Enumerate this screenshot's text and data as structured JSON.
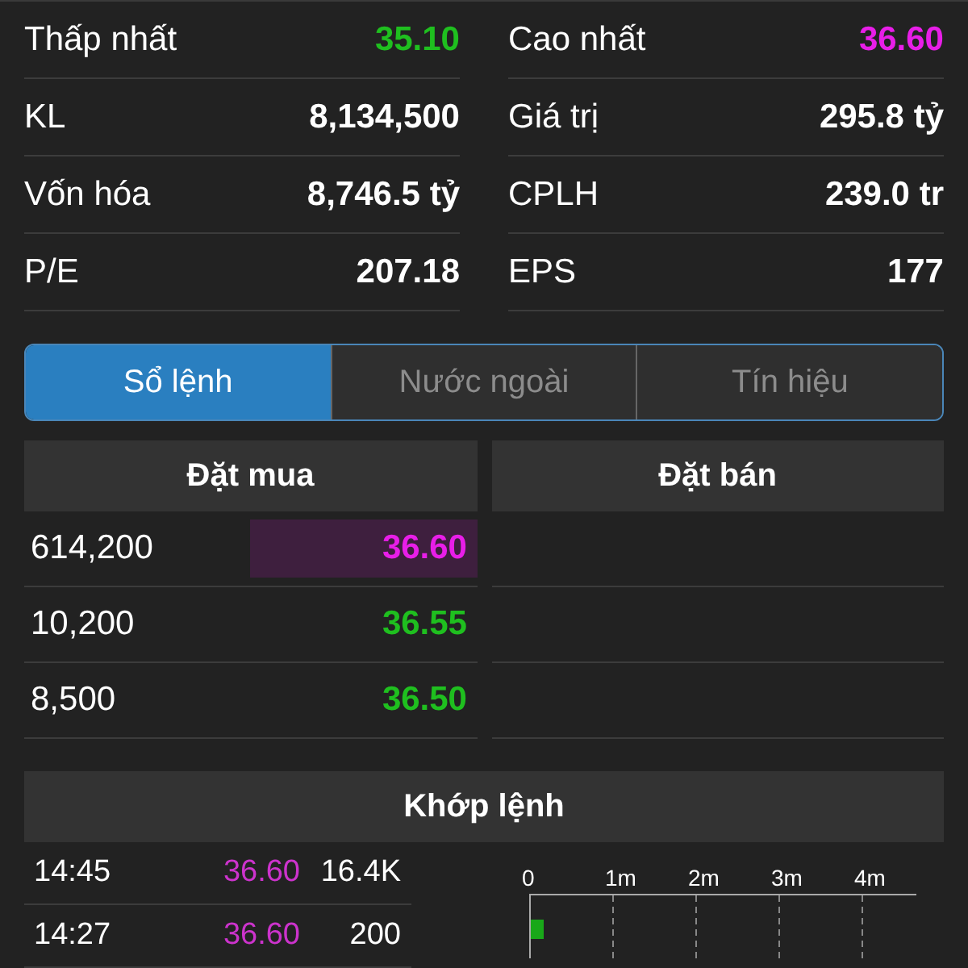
{
  "stats": [
    {
      "label": "Thấp nhất",
      "value": "35.10",
      "color": "#1fbf1f"
    },
    {
      "label": "Cao nhất",
      "value": "36.60",
      "color": "#e81ee8"
    },
    {
      "label": "KL",
      "value": "8,134,500",
      "color": "#ffffff"
    },
    {
      "label": "Giá trị",
      "value": "295.8 tỷ",
      "color": "#ffffff"
    },
    {
      "label": "Vốn hóa",
      "value": "8,746.5 tỷ",
      "color": "#ffffff"
    },
    {
      "label": "CPLH",
      "value": "239.0 tr",
      "color": "#ffffff"
    },
    {
      "label": "P/E",
      "value": "207.18",
      "color": "#ffffff"
    },
    {
      "label": "EPS",
      "value": "177",
      "color": "#ffffff"
    }
  ],
  "tabs": [
    {
      "label": "Sổ lệnh",
      "selected": true
    },
    {
      "label": "Nước ngoài",
      "selected": false
    },
    {
      "label": "Tín hiệu",
      "selected": false
    }
  ],
  "order_book": {
    "buy_title": "Đặt mua",
    "sell_title": "Đặt bán",
    "rows": [
      {
        "volume": "614,200",
        "price": "36.60",
        "color": "#e81ee8",
        "highlighted": true
      },
      {
        "volume": "10,200",
        "price": "36.55",
        "color": "#1fbf1f",
        "highlighted": false
      },
      {
        "volume": "8,500",
        "price": "36.50",
        "color": "#1fbf1f",
        "highlighted": false
      }
    ]
  },
  "matched": {
    "title": "Khớp lệnh",
    "rows": [
      {
        "time": "14:45",
        "price": "36.60",
        "color": "#cc33cc",
        "volume": "16.4K"
      },
      {
        "time": "14:27",
        "price": "36.60",
        "color": "#cc33cc",
        "volume": "200"
      }
    ],
    "chart": {
      "x_tick_labels": [
        "0",
        "1m",
        "2m",
        "3m",
        "4m"
      ]
    }
  }
}
